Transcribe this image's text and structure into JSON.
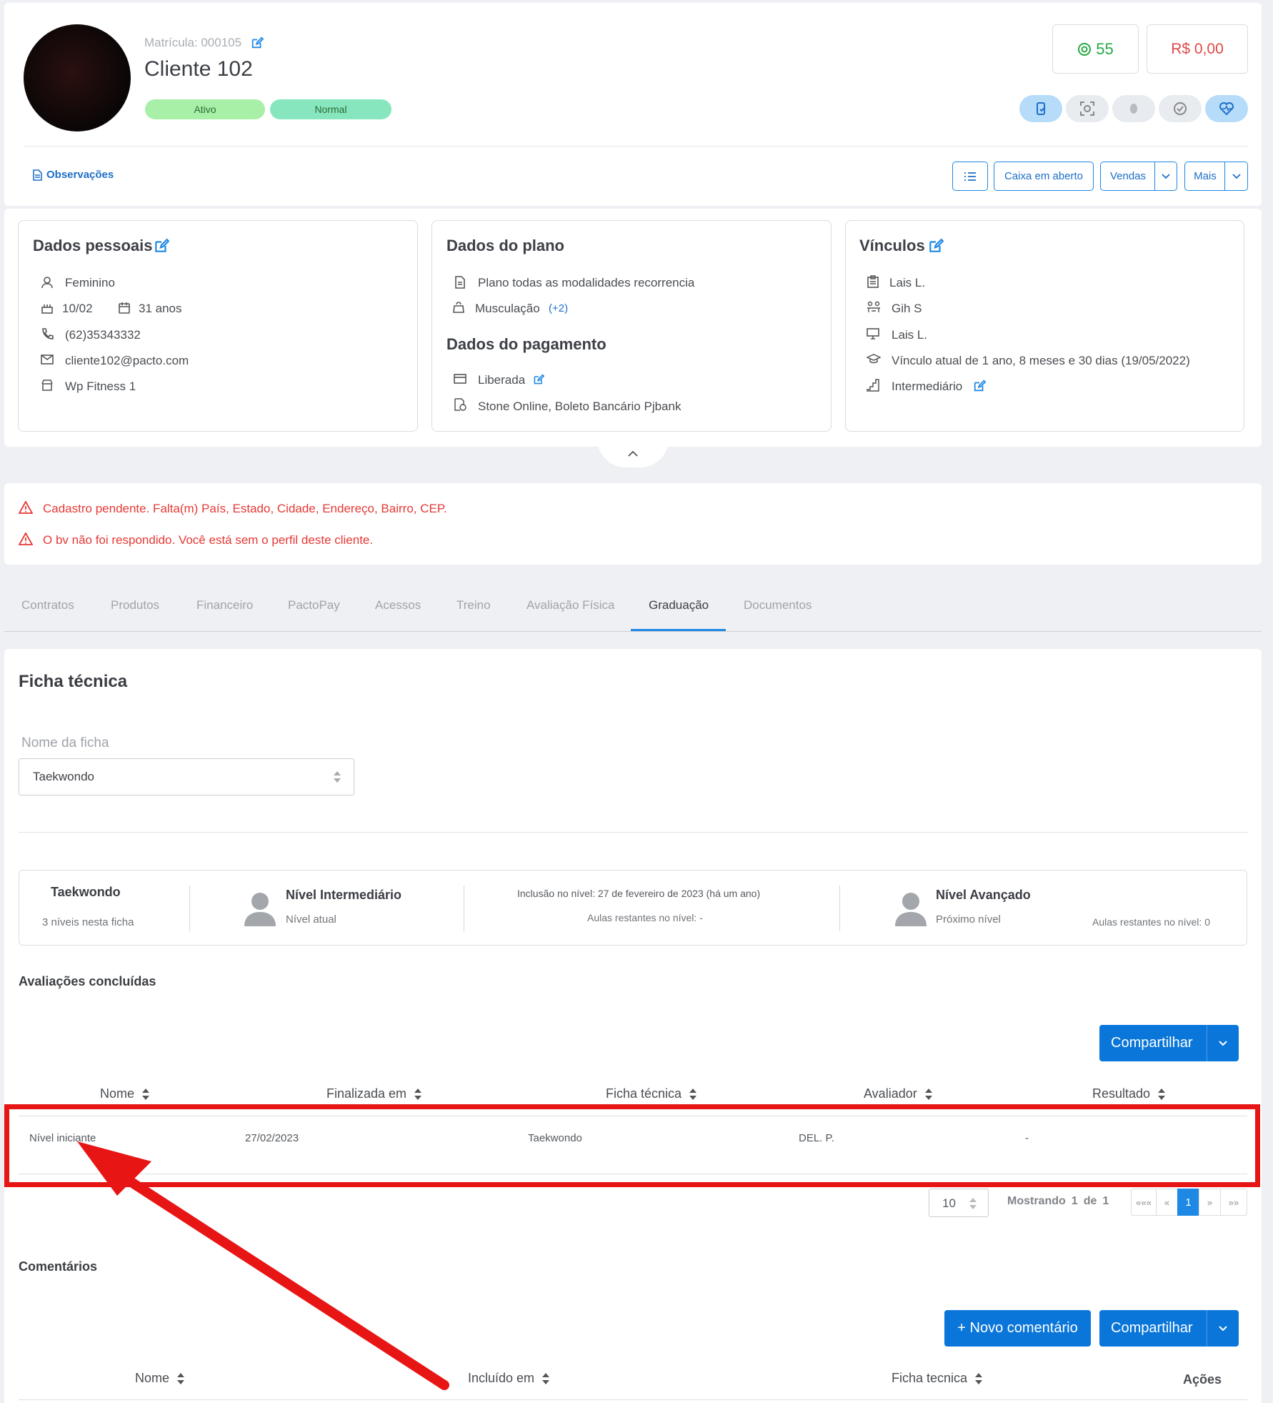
{
  "profile": {
    "matricula": "Matrícula: 000105",
    "name": "Cliente 102",
    "status_badge": "Ativo",
    "type_badge": "Normal",
    "points": "55",
    "balance": "R$ 0,00",
    "observacoes": "Observações"
  },
  "toolbar": {
    "caixa": "Caixa em aberto",
    "vendas": "Vendas",
    "mais": "Mais"
  },
  "dados_pessoais": {
    "title": "Dados pessoais",
    "gender": "Feminino",
    "birthday": "10/02",
    "age": "31 anos",
    "phone": "(62)35343332",
    "email": "cliente102@pacto.com",
    "unit": "Wp Fitness 1"
  },
  "dados_plano": {
    "title": "Dados do plano",
    "plano": "Plano todas as modalidades recorrencia",
    "modalidade": "Musculação",
    "extra": "(+2)",
    "pagamento_title": "Dados do pagamento",
    "liberada": "Liberada",
    "gateway": "Stone Online, Boleto Bancário Pjbank"
  },
  "vinculos": {
    "title": "Vínculos",
    "item1": "Lais L.",
    "item2": "Gih S",
    "item3": "Lais L.",
    "item4": "Vínculo atual de 1 ano, 8 meses e 30 dias (19/05/2022)",
    "item5": "Intermediário"
  },
  "alerts": [
    "Cadastro pendente. Falta(m) País, Estado, Cidade, Endereço, Bairro, CEP.",
    "O bv não foi respondido. Você está sem o perfil deste cliente."
  ],
  "tabs": [
    "Contratos",
    "Produtos",
    "Financeiro",
    "PactoPay",
    "Acessos",
    "Treino",
    "Avaliação Física",
    "Graduação",
    "Documentos"
  ],
  "ficha": {
    "title": "Ficha técnica",
    "select_label": "Nome da ficha",
    "select_value": "Taekwondo",
    "card_name": "Taekwondo",
    "card_levels": "3 níveis nesta ficha",
    "current_level": "Nível Intermediário",
    "current_label": "Nível atual",
    "inclusao": "Inclusão no nível: 27 de fevereiro de 2023 (há um ano)",
    "aulas": "Aulas restantes no nível: -",
    "next_level": "Nível Avançado",
    "next_label": "Próximo nível",
    "next_aulas": "Aulas restantes no nível: 0"
  },
  "avaliacoes": {
    "title": "Avaliações concluídas",
    "share": "Compartilhar",
    "headers": [
      "Nome",
      "Finalizada em",
      "Ficha técnica",
      "Avaliador",
      "Resultado"
    ],
    "row": [
      "Nível iniciante",
      "27/02/2023",
      "Taekwondo",
      "DEL. P.",
      "-"
    ],
    "page_size": "10",
    "showing": "Mostrando",
    "showing_from": "1",
    "showing_de": "de",
    "showing_total": "1",
    "pages": [
      "«««",
      "«",
      "1",
      "»",
      "»»"
    ]
  },
  "comentarios": {
    "title": "Comentários",
    "novo": "+ Novo comentário",
    "share": "Compartilhar",
    "headers": [
      "Nome",
      "Incluído em",
      "Ficha tecnica",
      "Ações"
    ]
  },
  "colors": {
    "accent": "#1e88e5",
    "primary_button": "#0a76d9",
    "alert": "#e53935",
    "badge_green": "#a8f0a8",
    "badge_teal": "#88e6bf",
    "highlight_box": "#e81515"
  }
}
